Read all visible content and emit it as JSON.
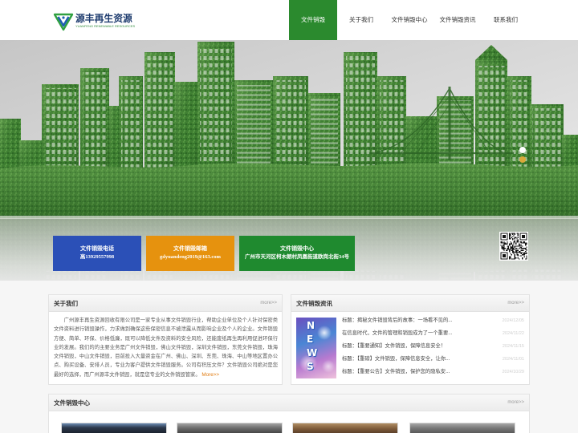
{
  "site": {
    "logo_title": "源丰再生资源",
    "logo_subtitle": "YUANFENG RENEWABLE RESOURCES",
    "logo_icon": "recycle-triangle-icon"
  },
  "colors": {
    "brand_green": "#2b8a2e",
    "more_orange": "#e07b10"
  },
  "nav": {
    "items": [
      {
        "label": "文件销毁",
        "active": true
      },
      {
        "label": "关于我们",
        "active": false
      },
      {
        "label": "文件销毁中心",
        "active": false
      },
      {
        "label": "文件销毁资讯",
        "active": false
      },
      {
        "label": "联系我们",
        "active": false
      }
    ]
  },
  "banner": {
    "slide_count": 2,
    "active_slide": 2,
    "contact_boxes": [
      {
        "title": "文件销毁电话",
        "value": "高13929557998",
        "color": "#2b50b7"
      },
      {
        "title": "文件销毁邮箱",
        "value": "gdyuandeng2019@163.com",
        "color": "#e6920e"
      },
      {
        "title": "文件销毁中心",
        "value": "广州市天河区柯木朗村凤凰街道欧岗北街34号",
        "color": "#1f8a2f"
      }
    ],
    "qr_icon": "qr-code-icon"
  },
  "about": {
    "title": "关于我们",
    "more": "more>>",
    "text": "广州源丰再生资源回收有限公司是一家专业从事文件销毁行业，帮助企业单位及个人针对保密类文件资料进行销毁操作，力求做到确保这些保密信息不被泄露从而影响企业及个人的企业。文件销毁方便、简单、环保、价格低廉，既可以降低文件及资料的安全风险，还能废纸再生再利用促进环保行业的发展。我们的的主要业务是广州文件销毁，佛山文件销毁，深圳文件销毁，东莞文件销毁，珠海文件销毁，中山文件销毁，目前投入大量资金在广州、佛山、深圳、东莞、珠海、中山等地区置办公点、购买设备、安排人员，专业为客户提供文件销毁服务。公司有积压文件？文件销毁公司绝对是您最好的选择，而广州源丰文件销毁，就是您专业的文件销毁管家。",
    "more_inline": "More>>"
  },
  "news": {
    "title": "文件销毁资讯",
    "more": "more>>",
    "image_text": "NEWS",
    "items": [
      {
        "title": "标题：揭秘文件销毁背后的故事：一场看不见的...",
        "date": "2024/12/05"
      },
      {
        "title": "在信息时代，文件的管理和销毁成为了一个重要...",
        "date": "2024/11/22"
      },
      {
        "title": "标题：【重要通知】文件销毁，保障信息安全！",
        "date": "2024/11/15"
      },
      {
        "title": "标题：【重磅】文件销毁，保障信息安全，让你...",
        "date": "2024/11/01"
      },
      {
        "title": "标题：【重要公告】文件销毁，保护您的隐私安...",
        "date": "2024/10/29"
      }
    ]
  },
  "center": {
    "title": "文件销毁中心",
    "more": "more>>"
  }
}
